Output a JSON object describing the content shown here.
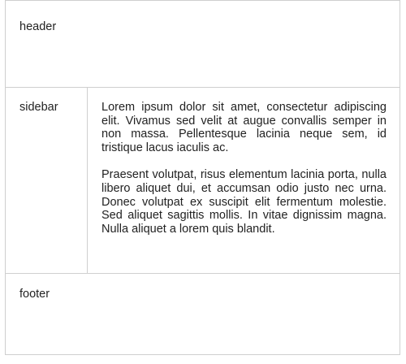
{
  "header": {
    "label": "header"
  },
  "sidebar": {
    "label": "sidebar"
  },
  "content": {
    "paragraphs": [
      "Lorem ipsum dolor sit amet, consectetur adipiscing elit. Vivamus sed velit at augue convallis semper in non massa. Pellentesque lacinia neque sem, id tristique lacus iaculis ac.",
      "Praesent volutpat, risus elementum lacinia porta, nulla libero aliquet dui, et accumsan odio justo nec urna. Donec volutpat ex suscipit elit fermentum molestie. Sed aliquet sagittis mollis. In vitae dignissim magna. Nulla aliquet a lorem quis blandit."
    ]
  },
  "footer": {
    "label": "footer"
  }
}
